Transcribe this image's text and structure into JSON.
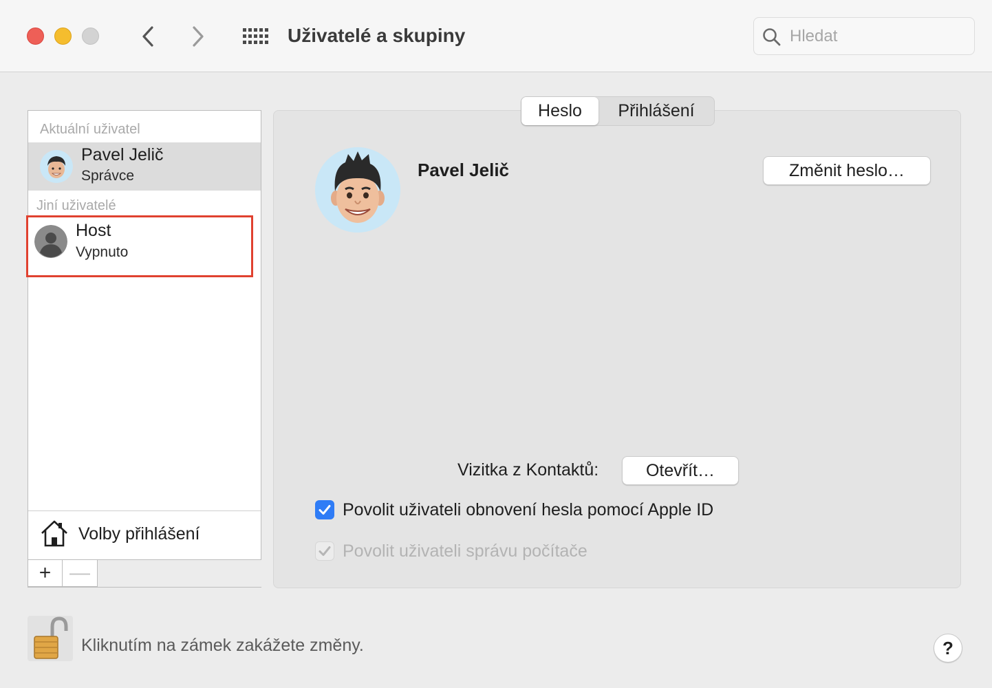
{
  "window": {
    "title": "Uživatelé a skupiny",
    "search_placeholder": "Hledat"
  },
  "toolbar": {
    "icons": [
      "close-button",
      "minimize-button",
      "zoom-button",
      "chevron-left-icon",
      "chevron-right-icon",
      "grid-icon",
      "search-icon"
    ]
  },
  "sidebar": {
    "current_label": "Aktuální uživatel",
    "others_label": "Jiní uživatelé",
    "current_user": {
      "name": "Pavel Jelič",
      "role": "Správce"
    },
    "guest_user": {
      "name": "Host",
      "status": "Vypnuto"
    },
    "login_options": "Volby přihlášení",
    "add_button": "+",
    "remove_button": "—"
  },
  "tabs": {
    "password": "Heslo",
    "login": "Přihlášení"
  },
  "panel": {
    "user_name": "Pavel Jelič",
    "change_password": "Změnit heslo…",
    "contact_card_label": "Vizitka z Kontaktů:",
    "open_button": "Otevřít…",
    "allow_reset_apple_id": "Povolit uživateli obnovení hesla pomocí Apple ID",
    "allow_reset_checked": true,
    "allow_admin": "Povolit uživateli správu počítače",
    "allow_admin_checked": true,
    "allow_admin_disabled": true
  },
  "footer": {
    "lock_text": "Kliknutím na zámek zakážete změny.",
    "help": "?"
  },
  "colors": {
    "accent": "#2f7cf6",
    "highlight_border": "#e0412f",
    "close": "#ee5f57",
    "minimize": "#f5bd2e"
  }
}
